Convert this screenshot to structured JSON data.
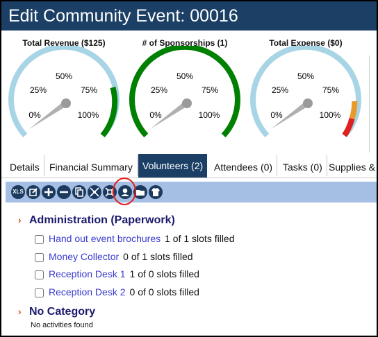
{
  "header": {
    "title": "Edit Community Event: 00016"
  },
  "gauges": [
    {
      "title": "Total Revenue ($125)",
      "labels": [
        "0%",
        "25%",
        "50%",
        "75%",
        "100%"
      ],
      "value_percent": 0,
      "band_color": "#008000"
    },
    {
      "title": "# of Sponsorships (1)",
      "labels": [
        "0%",
        "25%",
        "50%",
        "75%",
        "100%"
      ],
      "value_percent": 0,
      "band_color": "#008000"
    },
    {
      "title": "Total Expense ($0)",
      "labels": [
        "0%",
        "25%",
        "50%",
        "75%",
        "100%"
      ],
      "value_percent": 0,
      "band_color": "#e89a2c"
    }
  ],
  "tabs": [
    "Details",
    "Financial Summary",
    "Volunteers (2)",
    "Attendees (0)",
    "Tasks (0)",
    "Supplies &"
  ],
  "active_tab": "Volunteers (2)",
  "toolbar": {
    "xls_label": "XLS",
    "icons": [
      "xls-export-icon",
      "edit-icon",
      "add-icon",
      "remove-icon",
      "copy-icon",
      "expand-icon",
      "collapse-icon",
      "person-icon",
      "folder-icon",
      "shirt-icon"
    ]
  },
  "categories": [
    {
      "name": "Administration (Paperwork)",
      "activities": [
        {
          "name": "Hand out event brochures",
          "slots": "1 of 1 slots filled"
        },
        {
          "name": "Money Collector",
          "slots": "0 of 1 slots filled"
        },
        {
          "name": "Reception Desk 1",
          "slots": "1 of 0 slots filled"
        },
        {
          "name": "Reception Desk 2",
          "slots": "0 of 0 slots filled"
        }
      ]
    },
    {
      "name": "No Category",
      "empty_text": "No activities found"
    }
  ],
  "colors": {
    "header_bg": "#1c3f66",
    "toolbar_bg": "#a5bee3",
    "gauge_arc": "#a8d5e5",
    "category_text": "#1a1a6e",
    "link": "#3a3ad0"
  }
}
